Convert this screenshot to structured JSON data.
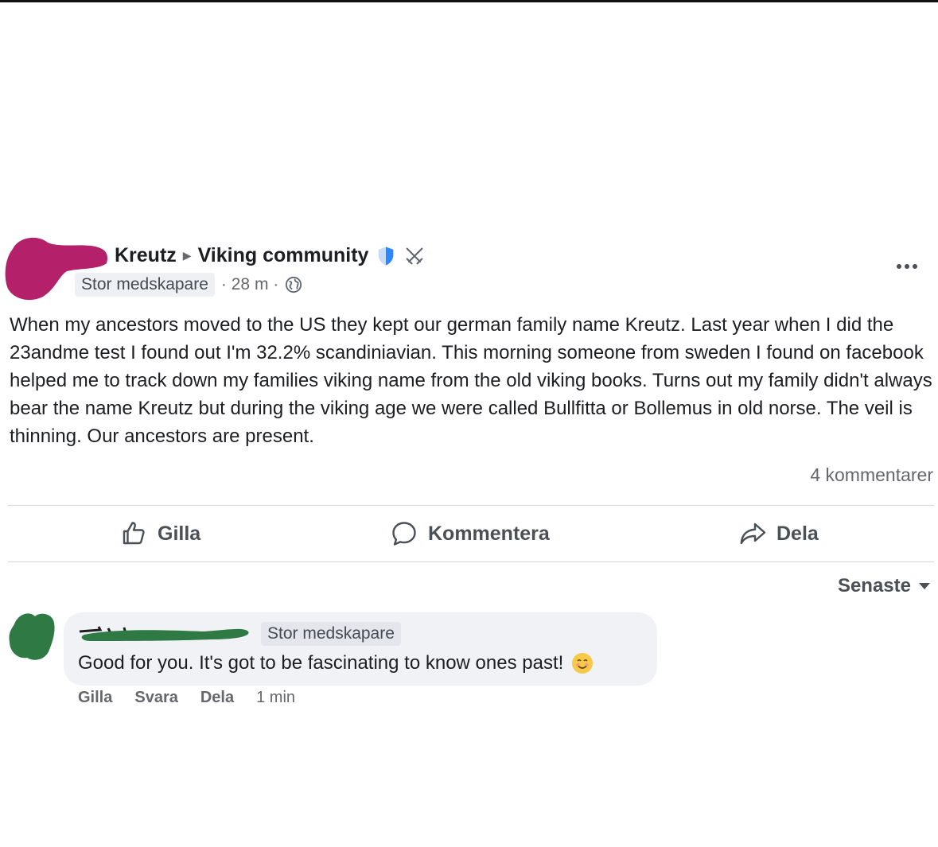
{
  "post": {
    "author_name": "Kreutz",
    "group_name": "Viking community",
    "role_badge": "Stor medskapare",
    "time_ago": "· 28 m ·",
    "body": "When my ancestors moved to the US they kept our german family name Kreutz. Last year when I did the 23andme test I found out I'm 32.2% scandiniavian.  This morning someone from sweden I found on facebook helped me to track down my families viking name from the old viking books. Turns out my family didn't always bear the name Kreutz but during the viking age we were called Bullfitta or Bollemus in old norse. The veil is thinning. Our ancestors are present.",
    "comment_count": "4 kommentarer",
    "icons": [
      "shield-icon",
      "crossed-swords-icon",
      "globe-icon",
      "more-icon"
    ]
  },
  "actions": {
    "like": "Gilla",
    "comment": "Kommentera",
    "share": "Dela"
  },
  "sort": {
    "label": "Senaste"
  },
  "comment": {
    "role_badge": "Stor medskapare",
    "text": "Good for you. It's got to be fascinating to know ones past!",
    "emoji": "smiling-face-icon",
    "actions": {
      "like": "Gilla",
      "reply": "Svara",
      "share": "Dela",
      "time": "1 min"
    }
  },
  "colors": {
    "author_scribble": "#b5206a",
    "commenter_scribble": "#2f7a44",
    "shield": "#2d88ff"
  }
}
